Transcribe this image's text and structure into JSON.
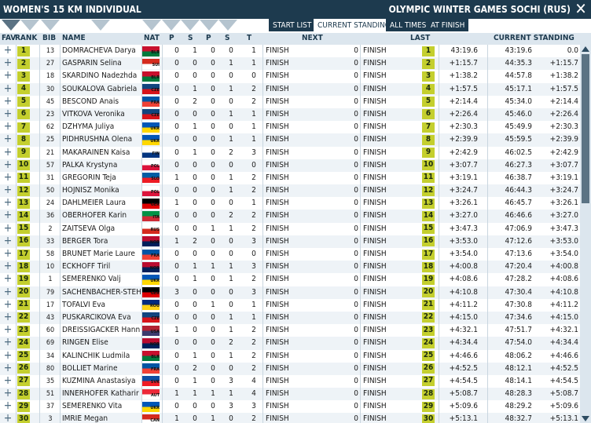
{
  "title": "WOMEN'S 15 KM INDIVIDUAL",
  "event": "OLYMPIC WINTER GAMES SOCHI (RUS)",
  "toolbar": {
    "start_list": "START LIST",
    "current_standing": "CURRENT STANDING",
    "all_times": "ALL TIMES",
    "at_finish": "AT FINISH"
  },
  "headers": {
    "fav": "FAV",
    "rank": "RANK",
    "bib": "BIB",
    "name": "NAME",
    "nat": "NAT",
    "p1": "P",
    "s1": "S",
    "p2": "P",
    "s2": "S",
    "t": "T",
    "next": "NEXT",
    "last": "LAST",
    "current": "CURRENT STANDING"
  },
  "colors": {
    "header_bg": "#1d3a4e",
    "rank_badge": "#c4cf2e",
    "row_alt": "#eef3f7"
  },
  "rows": [
    {
      "rank": "1",
      "bib": "13",
      "name": "DOMRACHEVA Darya",
      "nat": "BLR",
      "p1": "0",
      "s1": "1",
      "p2": "0",
      "s2": "0",
      "t": "1",
      "next": "FINISH",
      "nextv": "0",
      "last": "FINISH",
      "lrank": "1",
      "diff": "43:19.6",
      "time": "43:19.6",
      "cdiff": "0.0"
    },
    {
      "rank": "2",
      "bib": "27",
      "name": "GASPARIN Selina",
      "nat": "SUI",
      "p1": "0",
      "s1": "0",
      "p2": "0",
      "s2": "1",
      "t": "1",
      "next": "FINISH",
      "nextv": "0",
      "last": "FINISH",
      "lrank": "2",
      "diff": "+1:15.7",
      "time": "44:35.3",
      "cdiff": "+1:15.7"
    },
    {
      "rank": "3",
      "bib": "18",
      "name": "SKARDINO Nadezhda",
      "nat": "BLR",
      "p1": "0",
      "s1": "0",
      "p2": "0",
      "s2": "0",
      "t": "0",
      "next": "FINISH",
      "nextv": "0",
      "last": "FINISH",
      "lrank": "3",
      "diff": "+1:38.2",
      "time": "44:57.8",
      "cdiff": "+1:38.2"
    },
    {
      "rank": "4",
      "bib": "30",
      "name": "SOUKALOVA Gabriela",
      "nat": "CZE",
      "p1": "0",
      "s1": "1",
      "p2": "0",
      "s2": "1",
      "t": "2",
      "next": "FINISH",
      "nextv": "0",
      "last": "FINISH",
      "lrank": "4",
      "diff": "+1:57.5",
      "time": "45:17.1",
      "cdiff": "+1:57.5"
    },
    {
      "rank": "5",
      "bib": "45",
      "name": "BESCOND Anais",
      "nat": "FRA",
      "p1": "0",
      "s1": "2",
      "p2": "0",
      "s2": "0",
      "t": "2",
      "next": "FINISH",
      "nextv": "0",
      "last": "FINISH",
      "lrank": "5",
      "diff": "+2:14.4",
      "time": "45:34.0",
      "cdiff": "+2:14.4"
    },
    {
      "rank": "6",
      "bib": "23",
      "name": "VITKOVA Veronika",
      "nat": "CZE",
      "p1": "0",
      "s1": "0",
      "p2": "0",
      "s2": "1",
      "t": "1",
      "next": "FINISH",
      "nextv": "0",
      "last": "FINISH",
      "lrank": "6",
      "diff": "+2:26.4",
      "time": "45:46.0",
      "cdiff": "+2:26.4"
    },
    {
      "rank": "7",
      "bib": "62",
      "name": "DZHYMA Juliya",
      "nat": "UKR",
      "p1": "0",
      "s1": "1",
      "p2": "0",
      "s2": "0",
      "t": "1",
      "next": "FINISH",
      "nextv": "0",
      "last": "FINISH",
      "lrank": "7",
      "diff": "+2:30.3",
      "time": "45:49.9",
      "cdiff": "+2:30.3"
    },
    {
      "rank": "8",
      "bib": "25",
      "name": "PIDHRUSHNA Olena",
      "nat": "UKR",
      "p1": "0",
      "s1": "0",
      "p2": "0",
      "s2": "1",
      "t": "1",
      "next": "FINISH",
      "nextv": "0",
      "last": "FINISH",
      "lrank": "8",
      "diff": "+2:39.9",
      "time": "45:59.5",
      "cdiff": "+2:39.9"
    },
    {
      "rank": "9",
      "bib": "21",
      "name": "MAKARAINEN Kaisa",
      "nat": "FIN",
      "p1": "0",
      "s1": "1",
      "p2": "0",
      "s2": "2",
      "t": "3",
      "next": "FINISH",
      "nextv": "0",
      "last": "FINISH",
      "lrank": "9",
      "diff": "+2:42.9",
      "time": "46:02.5",
      "cdiff": "+2:42.9"
    },
    {
      "rank": "10",
      "bib": "57",
      "name": "PALKA Krystyna",
      "nat": "POL",
      "p1": "0",
      "s1": "0",
      "p2": "0",
      "s2": "0",
      "t": "0",
      "next": "FINISH",
      "nextv": "0",
      "last": "FINISH",
      "lrank": "10",
      "diff": "+3:07.7",
      "time": "46:27.3",
      "cdiff": "+3:07.7"
    },
    {
      "rank": "11",
      "bib": "31",
      "name": "GREGORIN Teja",
      "nat": "SLO",
      "p1": "1",
      "s1": "0",
      "p2": "0",
      "s2": "1",
      "t": "2",
      "next": "FINISH",
      "nextv": "0",
      "last": "FINISH",
      "lrank": "11",
      "diff": "+3:19.1",
      "time": "46:38.7",
      "cdiff": "+3:19.1"
    },
    {
      "rank": "12",
      "bib": "50",
      "name": "HOJNISZ Monika",
      "nat": "POL",
      "p1": "0",
      "s1": "0",
      "p2": "0",
      "s2": "1",
      "t": "2",
      "next": "FINISH",
      "nextv": "0",
      "last": "FINISH",
      "lrank": "12",
      "diff": "+3:24.7",
      "time": "46:44.3",
      "cdiff": "+3:24.7"
    },
    {
      "rank": "13",
      "bib": "24",
      "name": "DAHLMEIER Laura",
      "nat": "GER",
      "p1": "1",
      "s1": "0",
      "p2": "0",
      "s2": "0",
      "t": "1",
      "next": "FINISH",
      "nextv": "0",
      "last": "FINISH",
      "lrank": "13",
      "diff": "+3:26.1",
      "time": "46:45.7",
      "cdiff": "+3:26.1"
    },
    {
      "rank": "14",
      "bib": "36",
      "name": "OBERHOFER Karin",
      "nat": "ITA",
      "p1": "0",
      "s1": "0",
      "p2": "0",
      "s2": "2",
      "t": "2",
      "next": "FINISH",
      "nextv": "0",
      "last": "FINISH",
      "lrank": "14",
      "diff": "+3:27.0",
      "time": "46:46.6",
      "cdiff": "+3:27.0"
    },
    {
      "rank": "15",
      "bib": "2",
      "name": "ZAITSEVA Olga",
      "nat": "RUS",
      "p1": "0",
      "s1": "0",
      "p2": "1",
      "s2": "1",
      "t": "2",
      "next": "FINISH",
      "nextv": "0",
      "last": "FINISH",
      "lrank": "15",
      "diff": "+3:47.3",
      "time": "47:06.9",
      "cdiff": "+3:47.3"
    },
    {
      "rank": "16",
      "bib": "33",
      "name": "BERGER Tora",
      "nat": "NOR",
      "p1": "1",
      "s1": "2",
      "p2": "0",
      "s2": "0",
      "t": "3",
      "next": "FINISH",
      "nextv": "0",
      "last": "FINISH",
      "lrank": "16",
      "diff": "+3:53.0",
      "time": "47:12.6",
      "cdiff": "+3:53.0"
    },
    {
      "rank": "17",
      "bib": "58",
      "name": "BRUNET Marie Laure",
      "nat": "FRA",
      "p1": "0",
      "s1": "0",
      "p2": "0",
      "s2": "0",
      "t": "0",
      "next": "FINISH",
      "nextv": "0",
      "last": "FINISH",
      "lrank": "17",
      "diff": "+3:54.0",
      "time": "47:13.6",
      "cdiff": "+3:54.0"
    },
    {
      "rank": "18",
      "bib": "10",
      "name": "ECKHOFF Tiril",
      "nat": "NOR",
      "p1": "0",
      "s1": "1",
      "p2": "1",
      "s2": "1",
      "t": "3",
      "next": "FINISH",
      "nextv": "0",
      "last": "FINISH",
      "lrank": "18",
      "diff": "+4:00.8",
      "time": "47:20.4",
      "cdiff": "+4:00.8"
    },
    {
      "rank": "19",
      "bib": "1",
      "name": "SEMERENKO Valj",
      "nat": "UKR",
      "p1": "0",
      "s1": "1",
      "p2": "0",
      "s2": "1",
      "t": "2",
      "next": "FINISH",
      "nextv": "0",
      "last": "FINISH",
      "lrank": "19",
      "diff": "+4:08.6",
      "time": "47:28.2",
      "cdiff": "+4:08.6"
    },
    {
      "rank": "20",
      "bib": "79",
      "name": "SACHENBACHER-STEH",
      "nat": "GER",
      "p1": "3",
      "s1": "0",
      "p2": "0",
      "s2": "0",
      "t": "3",
      "next": "FINISH",
      "nextv": "0",
      "last": "FINISH",
      "lrank": "20",
      "diff": "+4:10.8",
      "time": "47:30.4",
      "cdiff": "+4:10.8"
    },
    {
      "rank": "21",
      "bib": "17",
      "name": "TOFALVI Eva",
      "nat": "ROU",
      "p1": "0",
      "s1": "0",
      "p2": "1",
      "s2": "0",
      "t": "1",
      "next": "FINISH",
      "nextv": "0",
      "last": "FINISH",
      "lrank": "21",
      "diff": "+4:11.2",
      "time": "47:30.8",
      "cdiff": "+4:11.2"
    },
    {
      "rank": "22",
      "bib": "43",
      "name": "PUSKARCIKOVA Eva",
      "nat": "CZE",
      "p1": "0",
      "s1": "0",
      "p2": "0",
      "s2": "1",
      "t": "1",
      "next": "FINISH",
      "nextv": "0",
      "last": "FINISH",
      "lrank": "22",
      "diff": "+4:15.0",
      "time": "47:34.6",
      "cdiff": "+4:15.0"
    },
    {
      "rank": "23",
      "bib": "60",
      "name": "DREISSIGACKER Hann",
      "nat": "USA",
      "p1": "1",
      "s1": "0",
      "p2": "0",
      "s2": "1",
      "t": "2",
      "next": "FINISH",
      "nextv": "0",
      "last": "FINISH",
      "lrank": "23",
      "diff": "+4:32.1",
      "time": "47:51.7",
      "cdiff": "+4:32.1"
    },
    {
      "rank": "24",
      "bib": "69",
      "name": "RINGEN Elise",
      "nat": "NOR",
      "p1": "0",
      "s1": "0",
      "p2": "0",
      "s2": "2",
      "t": "2",
      "next": "FINISH",
      "nextv": "0",
      "last": "FINISH",
      "lrank": "24",
      "diff": "+4:34.4",
      "time": "47:54.0",
      "cdiff": "+4:34.4"
    },
    {
      "rank": "25",
      "bib": "34",
      "name": "KALINCHIK Ludmila",
      "nat": "BLR",
      "p1": "0",
      "s1": "1",
      "p2": "0",
      "s2": "1",
      "t": "2",
      "next": "FINISH",
      "nextv": "0",
      "last": "FINISH",
      "lrank": "25",
      "diff": "+4:46.6",
      "time": "48:06.2",
      "cdiff": "+4:46.6"
    },
    {
      "rank": "26",
      "bib": "80",
      "name": "BOLLIET Marine",
      "nat": "FRA",
      "p1": "0",
      "s1": "2",
      "p2": "0",
      "s2": "0",
      "t": "2",
      "next": "FINISH",
      "nextv": "0",
      "last": "FINISH",
      "lrank": "26",
      "diff": "+4:52.5",
      "time": "48:12.1",
      "cdiff": "+4:52.5"
    },
    {
      "rank": "27",
      "bib": "35",
      "name": "KUZMINA Anastasiya",
      "nat": "SVK",
      "p1": "0",
      "s1": "1",
      "p2": "0",
      "s2": "3",
      "t": "4",
      "next": "FINISH",
      "nextv": "0",
      "last": "FINISH",
      "lrank": "27",
      "diff": "+4:54.5",
      "time": "48:14.1",
      "cdiff": "+4:54.5"
    },
    {
      "rank": "28",
      "bib": "51",
      "name": "INNERHOFER Katharir",
      "nat": "AUT",
      "p1": "1",
      "s1": "1",
      "p2": "1",
      "s2": "1",
      "t": "4",
      "next": "FINISH",
      "nextv": "0",
      "last": "FINISH",
      "lrank": "28",
      "diff": "+5:08.7",
      "time": "48:28.3",
      "cdiff": "+5:08.7"
    },
    {
      "rank": "29",
      "bib": "37",
      "name": "SEMERENKO Vita",
      "nat": "UKR",
      "p1": "0",
      "s1": "0",
      "p2": "0",
      "s2": "3",
      "t": "3",
      "next": "FINISH",
      "nextv": "0",
      "last": "FINISH",
      "lrank": "29",
      "diff": "+5:09.6",
      "time": "48:29.2",
      "cdiff": "+5:09.6"
    },
    {
      "rank": "30",
      "bib": "3",
      "name": "IMRIE Megan",
      "nat": "CAN",
      "p1": "1",
      "s1": "0",
      "p2": "1",
      "s2": "0",
      "t": "2",
      "next": "FINISH",
      "nextv": "0",
      "last": "FINISH",
      "lrank": "30",
      "diff": "+5:13.1",
      "time": "48:32.7",
      "cdiff": "+5:13.1"
    }
  ]
}
